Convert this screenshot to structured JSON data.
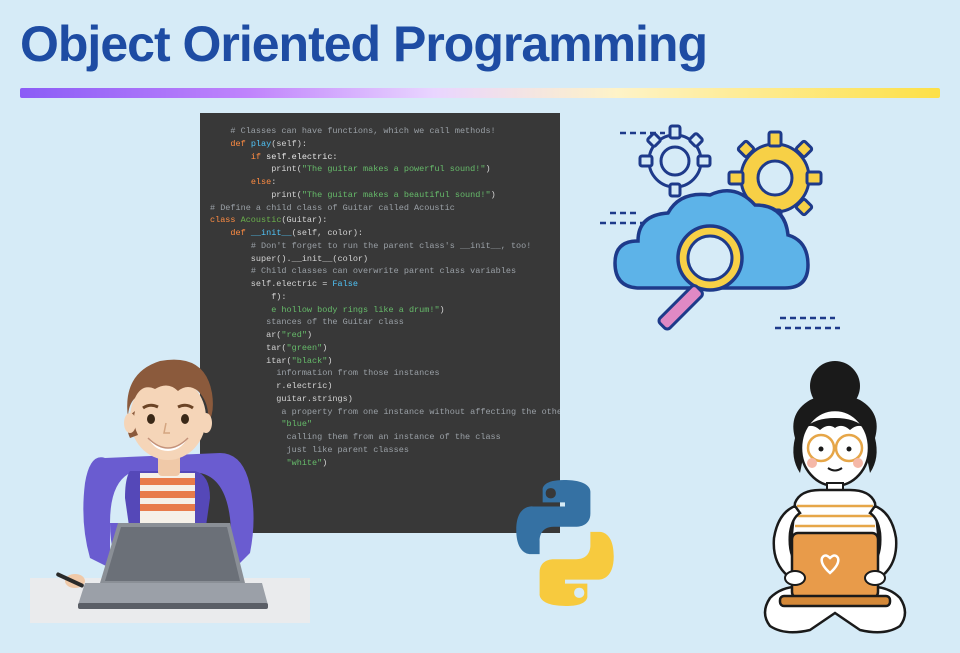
{
  "header": {
    "title": "Object Oriented Programming"
  },
  "code": {
    "lines": [
      {
        "segments": [
          {
            "t": "    ",
            "c": ""
          },
          {
            "t": "# Classes can have functions, which we call methods!",
            "c": "c-comment"
          }
        ]
      },
      {
        "segments": [
          {
            "t": "    ",
            "c": ""
          },
          {
            "t": "def ",
            "c": "c-keyword"
          },
          {
            "t": "play",
            "c": "c-def"
          },
          {
            "t": "(self):",
            "c": ""
          }
        ]
      },
      {
        "segments": [
          {
            "t": "        ",
            "c": ""
          },
          {
            "t": "if ",
            "c": "c-keyword"
          },
          {
            "t": "self.electric:",
            "c": "c-self"
          }
        ]
      },
      {
        "segments": [
          {
            "t": "            print(",
            "c": ""
          },
          {
            "t": "\"The guitar makes a powerful sound!\"",
            "c": "c-string"
          },
          {
            "t": ")",
            "c": ""
          }
        ]
      },
      {
        "segments": [
          {
            "t": "        ",
            "c": ""
          },
          {
            "t": "else",
            "c": "c-keyword"
          },
          {
            "t": ":",
            "c": ""
          }
        ]
      },
      {
        "segments": [
          {
            "t": "            print(",
            "c": ""
          },
          {
            "t": "\"The guitar makes a beautiful sound!\"",
            "c": "c-string"
          },
          {
            "t": ")",
            "c": ""
          }
        ]
      },
      {
        "segments": [
          {
            "t": "",
            "c": ""
          }
        ]
      },
      {
        "segments": [
          {
            "t": "# Define a child class of Guitar called Acoustic",
            "c": "c-comment"
          }
        ]
      },
      {
        "segments": [
          {
            "t": "class ",
            "c": "c-keyword"
          },
          {
            "t": "Acoustic",
            "c": "c-class"
          },
          {
            "t": "(Guitar):",
            "c": ""
          }
        ]
      },
      {
        "segments": [
          {
            "t": "    ",
            "c": ""
          },
          {
            "t": "def ",
            "c": "c-keyword"
          },
          {
            "t": "__init__",
            "c": "c-def"
          },
          {
            "t": "(self, color):",
            "c": ""
          }
        ]
      },
      {
        "segments": [
          {
            "t": "        ",
            "c": ""
          },
          {
            "t": "# Don't forget to run the parent class's __init__, too!",
            "c": "c-comment"
          }
        ]
      },
      {
        "segments": [
          {
            "t": "        super().__init__(color)",
            "c": ""
          }
        ]
      },
      {
        "segments": [
          {
            "t": "",
            "c": ""
          }
        ]
      },
      {
        "segments": [
          {
            "t": "        ",
            "c": ""
          },
          {
            "t": "# Child classes can overwrite parent class variables",
            "c": "c-comment"
          }
        ]
      },
      {
        "segments": [
          {
            "t": "        self.electric = ",
            "c": ""
          },
          {
            "t": "False",
            "c": "c-false"
          }
        ]
      },
      {
        "segments": [
          {
            "t": "",
            "c": ""
          }
        ]
      },
      {
        "segments": [
          {
            "t": "            f):",
            "c": ""
          }
        ]
      },
      {
        "segments": [
          {
            "t": "            ",
            "c": ""
          },
          {
            "t": "e hollow body rings like a drum!\"",
            "c": "c-string"
          },
          {
            "t": ")",
            "c": ""
          }
        ]
      },
      {
        "segments": [
          {
            "t": "",
            "c": ""
          }
        ]
      },
      {
        "segments": [
          {
            "t": "           ",
            "c": ""
          },
          {
            "t": "stances of the Guitar class",
            "c": "c-comment"
          }
        ]
      },
      {
        "segments": [
          {
            "t": "           ar(",
            "c": ""
          },
          {
            "t": "\"red\"",
            "c": "c-string"
          },
          {
            "t": ")",
            "c": ""
          }
        ]
      },
      {
        "segments": [
          {
            "t": "           tar(",
            "c": ""
          },
          {
            "t": "\"green\"",
            "c": "c-string"
          },
          {
            "t": ")",
            "c": ""
          }
        ]
      },
      {
        "segments": [
          {
            "t": "           itar(",
            "c": ""
          },
          {
            "t": "\"black\"",
            "c": "c-string"
          },
          {
            "t": ")",
            "c": ""
          }
        ]
      },
      {
        "segments": [
          {
            "t": "",
            "c": ""
          }
        ]
      },
      {
        "segments": [
          {
            "t": "             ",
            "c": ""
          },
          {
            "t": "information from those instances",
            "c": "c-comment"
          }
        ]
      },
      {
        "segments": [
          {
            "t": "             r.electric)",
            "c": ""
          }
        ]
      },
      {
        "segments": [
          {
            "t": "             guitar.strings)",
            "c": ""
          }
        ]
      },
      {
        "segments": [
          {
            "t": "",
            "c": ""
          }
        ]
      },
      {
        "segments": [
          {
            "t": "              ",
            "c": ""
          },
          {
            "t": "a property from one instance without affecting the others",
            "c": "c-comment"
          }
        ]
      },
      {
        "segments": [
          {
            "t": "              ",
            "c": ""
          },
          {
            "t": "\"blue\"",
            "c": "c-string"
          }
        ]
      },
      {
        "segments": [
          {
            "t": "",
            "c": ""
          }
        ]
      },
      {
        "segments": [
          {
            "t": "",
            "c": ""
          }
        ]
      },
      {
        "segments": [
          {
            "t": "",
            "c": ""
          }
        ]
      },
      {
        "segments": [
          {
            "t": "               ",
            "c": ""
          },
          {
            "t": "calling them from an instance of the class",
            "c": "c-comment"
          }
        ]
      },
      {
        "segments": [
          {
            "t": "",
            "c": ""
          }
        ]
      },
      {
        "segments": [
          {
            "t": "",
            "c": ""
          }
        ]
      },
      {
        "segments": [
          {
            "t": "               ",
            "c": ""
          },
          {
            "t": "just like parent classes",
            "c": "c-comment"
          }
        ]
      },
      {
        "segments": [
          {
            "t": "               ",
            "c": ""
          },
          {
            "t": "\"white\"",
            "c": "c-string"
          },
          {
            "t": ")",
            "c": ""
          }
        ]
      }
    ]
  },
  "illustrations": {
    "cloud_name": "cloud-search-gears",
    "boy_name": "boy-with-laptop",
    "python_name": "python-logo",
    "girl_name": "girl-with-laptop"
  },
  "colors": {
    "accent_blue": "#1e4ca3",
    "bg": "#d6ebf7",
    "editor_bg": "#383838"
  }
}
